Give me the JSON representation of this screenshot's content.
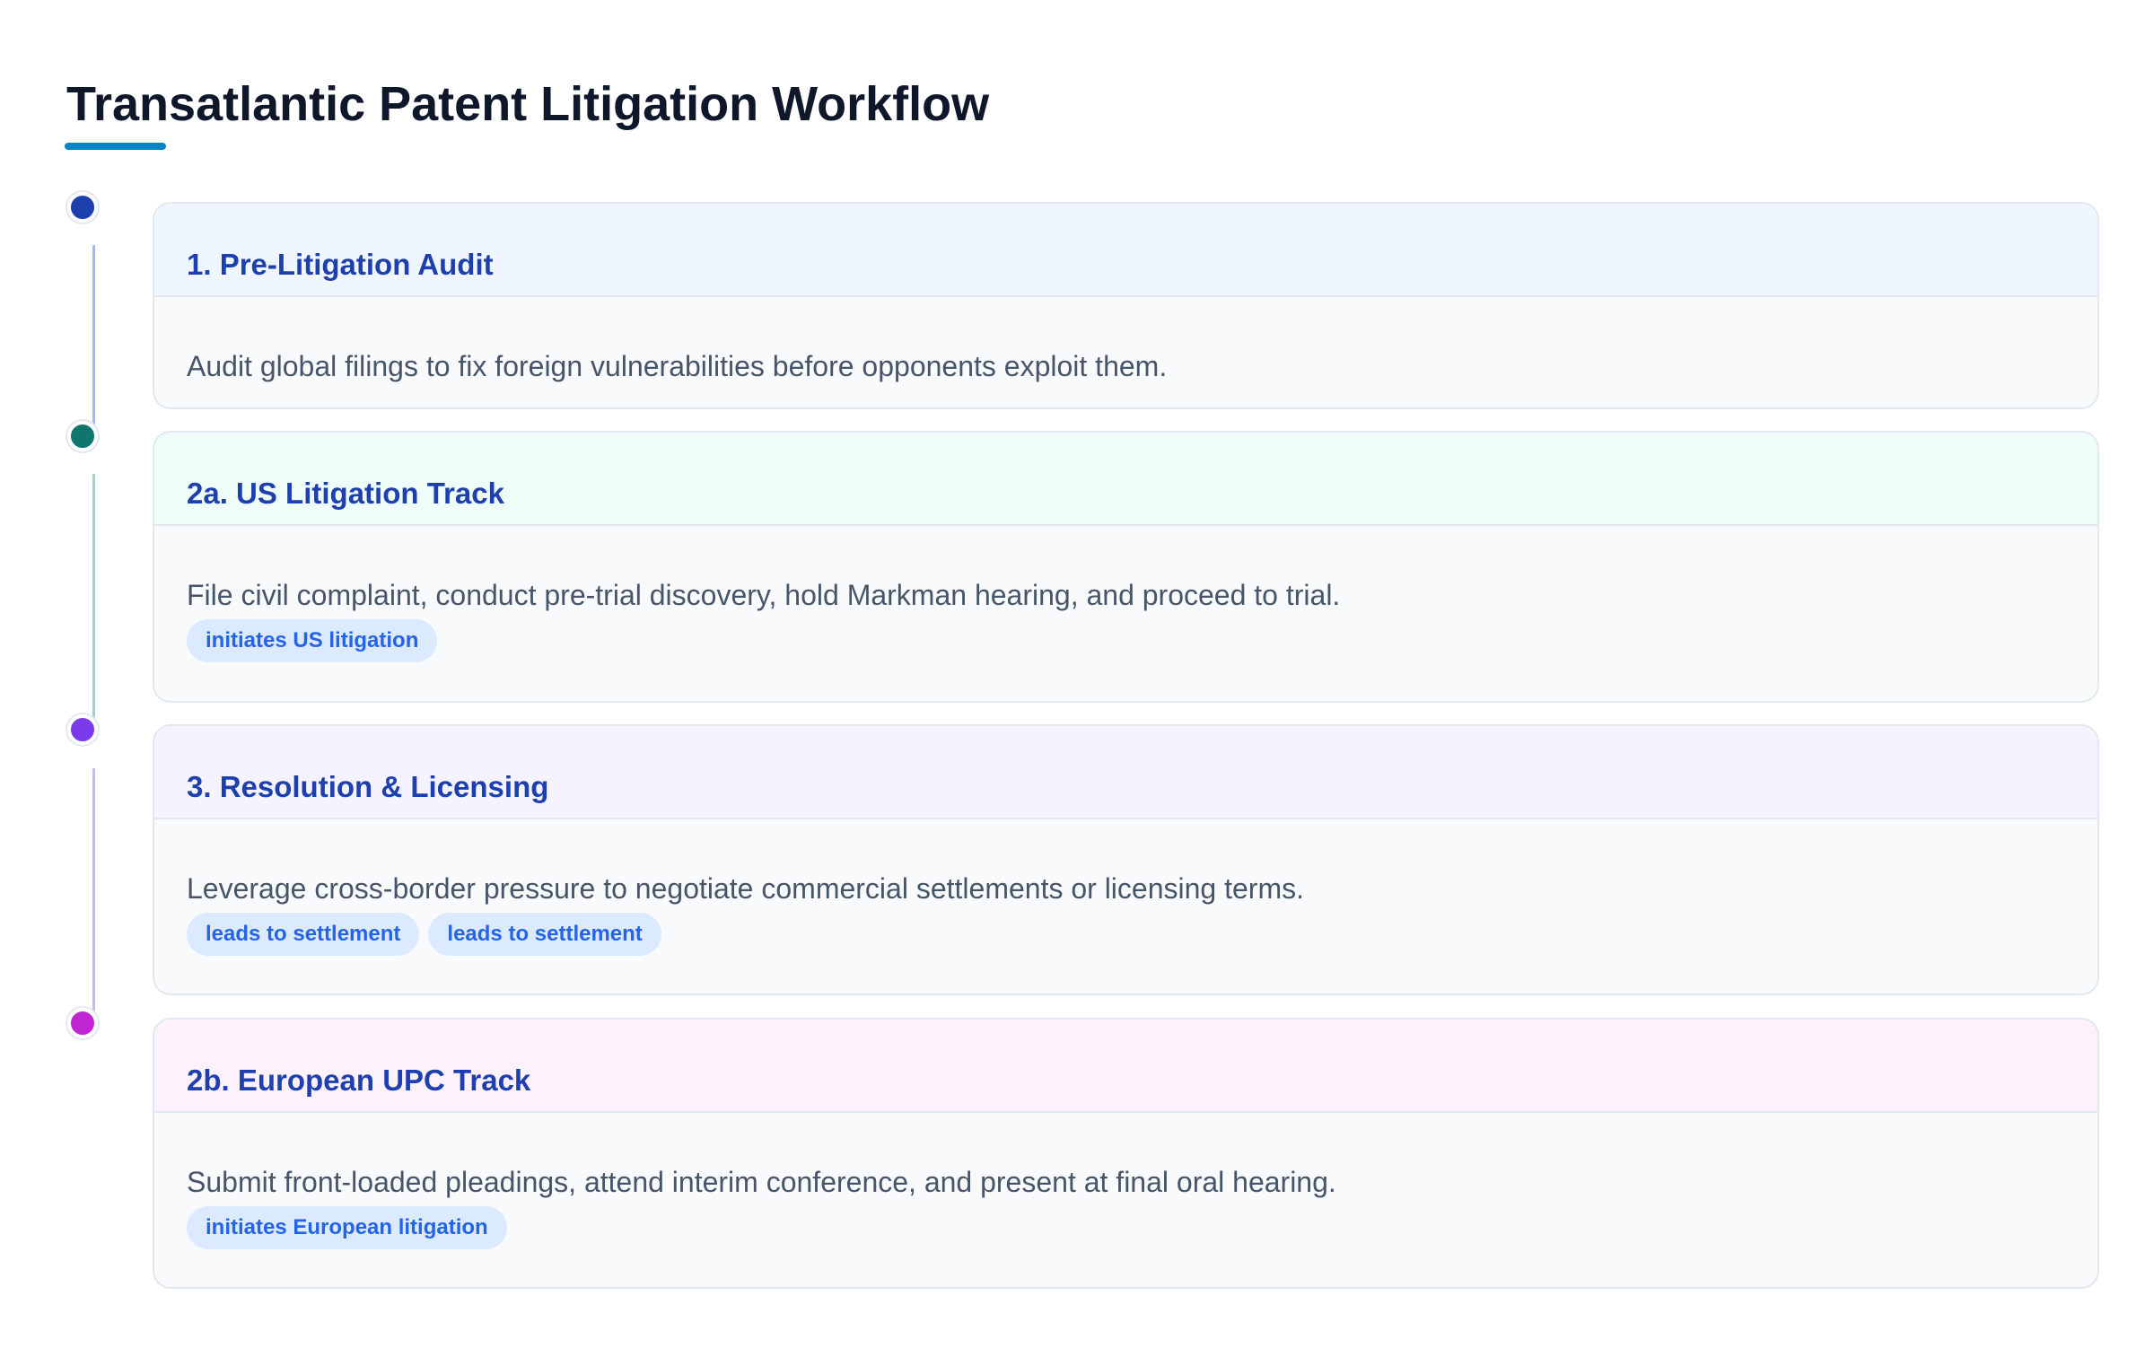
{
  "title": "Transatlantic Patent Litigation Workflow",
  "colors": {
    "accent": "#0284c7",
    "title_text": "#0f172a",
    "step_title": "#1e40af",
    "tag_bg": "#dbeafe",
    "tag_text": "#2563eb"
  },
  "steps": [
    {
      "title": "1. Pre-Litigation Audit",
      "description": "Audit global filings to fix foreign vulnerabilities before opponents exploit them.",
      "tags": [],
      "dot_color": "#1e40af",
      "line_color": "#a5b4fc",
      "header_bg": "#eff6ff"
    },
    {
      "title": "2a. US Litigation Track",
      "description": "File civil complaint, conduct pre-trial discovery, hold Markman hearing, and proceed to trial.",
      "tags": [
        "initiates US litigation"
      ],
      "dot_color": "#0f766e",
      "line_color": "#99d5cd",
      "header_bg": "#effdf8"
    },
    {
      "title": "3. Resolution & Licensing",
      "description": "Leverage cross-border pressure to negotiate commercial settlements or licensing terms.",
      "tags": [
        "leads to settlement",
        "leads to settlement"
      ],
      "dot_color": "#7c3aed",
      "line_color": "#c4b5fd",
      "header_bg": "#f5f3ff"
    },
    {
      "title": "2b. European UPC Track",
      "description": "Submit front-loaded pleadings, attend interim conference, and present at final oral hearing.",
      "tags": [
        "initiates European litigation"
      ],
      "dot_color": "#c026d3",
      "line_color": "",
      "header_bg": "#fdf2fc"
    }
  ]
}
